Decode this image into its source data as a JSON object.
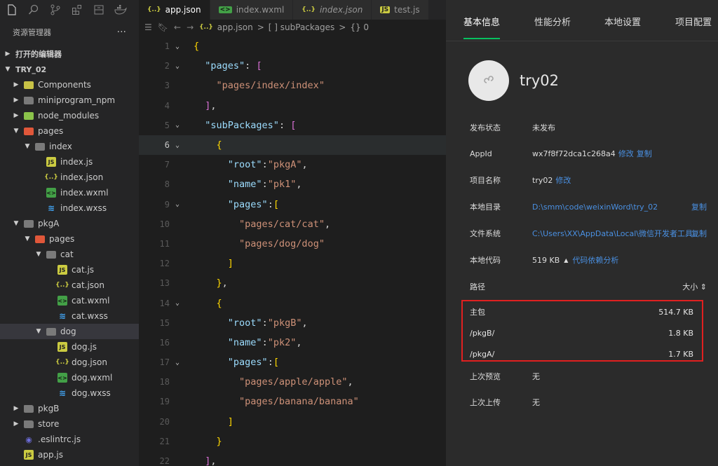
{
  "explorer": {
    "title": "资源管理器",
    "more": "···",
    "open_editors": "打开的编辑器",
    "project": "TRY_02",
    "items": [
      {
        "label": "Components",
        "depth": 1,
        "chev": "right",
        "icon": "folder-comp"
      },
      {
        "label": "miniprogram_npm",
        "depth": 1,
        "chev": "right",
        "icon": "folder"
      },
      {
        "label": "node_modules",
        "depth": 1,
        "chev": "right",
        "icon": "folder-node"
      },
      {
        "label": "pages",
        "depth": 1,
        "chev": "down",
        "icon": "folder-red"
      },
      {
        "label": "index",
        "depth": 2,
        "chev": "down",
        "icon": "folder-open"
      },
      {
        "label": "index.js",
        "depth": 3,
        "chev": "",
        "icon": "js"
      },
      {
        "label": "index.json",
        "depth": 3,
        "chev": "",
        "icon": "json"
      },
      {
        "label": "index.wxml",
        "depth": 3,
        "chev": "",
        "icon": "wxml"
      },
      {
        "label": "index.wxss",
        "depth": 3,
        "chev": "",
        "icon": "wxss"
      },
      {
        "label": "pkgA",
        "depth": 1,
        "chev": "down",
        "icon": "folder-open"
      },
      {
        "label": "pages",
        "depth": 2,
        "chev": "down",
        "icon": "folder-red"
      },
      {
        "label": "cat",
        "depth": 3,
        "chev": "down",
        "icon": "folder-open"
      },
      {
        "label": "cat.js",
        "depth": 4,
        "chev": "",
        "icon": "js"
      },
      {
        "label": "cat.json",
        "depth": 4,
        "chev": "",
        "icon": "json"
      },
      {
        "label": "cat.wxml",
        "depth": 4,
        "chev": "",
        "icon": "wxml"
      },
      {
        "label": "cat.wxss",
        "depth": 4,
        "chev": "",
        "icon": "wxss"
      },
      {
        "label": "dog",
        "depth": 3,
        "chev": "down",
        "icon": "folder-open",
        "selected": true
      },
      {
        "label": "dog.js",
        "depth": 4,
        "chev": "",
        "icon": "js"
      },
      {
        "label": "dog.json",
        "depth": 4,
        "chev": "",
        "icon": "json"
      },
      {
        "label": "dog.wxml",
        "depth": 4,
        "chev": "",
        "icon": "wxml"
      },
      {
        "label": "dog.wxss",
        "depth": 4,
        "chev": "",
        "icon": "wxss"
      },
      {
        "label": "pkgB",
        "depth": 1,
        "chev": "right",
        "icon": "folder"
      },
      {
        "label": "store",
        "depth": 1,
        "chev": "right",
        "icon": "folder"
      },
      {
        "label": ".eslintrc.js",
        "depth": 1,
        "chev": "",
        "icon": "eslint"
      },
      {
        "label": "app.js",
        "depth": 1,
        "chev": "",
        "icon": "js"
      }
    ]
  },
  "tabs": [
    {
      "label": "app.json",
      "icon": "{..}",
      "type": "json",
      "active": true
    },
    {
      "label": "index.wxml",
      "icon": "<>",
      "type": "wxml"
    },
    {
      "label": "index.json",
      "icon": "{..}",
      "type": "json",
      "italic": true
    },
    {
      "label": "test.js",
      "icon": "JS",
      "type": "js"
    }
  ],
  "breadcrumb": [
    "app.json",
    ">",
    "[ ] subPackages",
    ">",
    "{} 0"
  ],
  "code": [
    {
      "n": "1",
      "fold": "v",
      "t": [
        [
          "b",
          "{"
        ]
      ]
    },
    {
      "n": "2",
      "fold": "v",
      "t": [
        [
          "w",
          "  "
        ],
        [
          "k",
          "\"pages\""
        ],
        [
          "w",
          ": "
        ],
        [
          "p",
          "["
        ]
      ]
    },
    {
      "n": "3",
      "fold": "",
      "t": [
        [
          "w",
          "    "
        ],
        [
          "s",
          "\"pages/index/index\""
        ]
      ]
    },
    {
      "n": "4",
      "fold": "",
      "t": [
        [
          "w",
          "  "
        ],
        [
          "p",
          "]"
        ],
        [
          "w",
          ","
        ]
      ]
    },
    {
      "n": "5",
      "fold": "v",
      "t": [
        [
          "w",
          "  "
        ],
        [
          "k",
          "\"subPackages\""
        ],
        [
          "w",
          ": "
        ],
        [
          "p",
          "["
        ]
      ]
    },
    {
      "n": "6",
      "fold": "v",
      "cur": true,
      "t": [
        [
          "w",
          "    "
        ],
        [
          "b",
          "{"
        ]
      ]
    },
    {
      "n": "7",
      "fold": "",
      "t": [
        [
          "w",
          "      "
        ],
        [
          "k",
          "\"root\""
        ],
        [
          "w",
          ":"
        ],
        [
          "s",
          "\"pkgA\""
        ],
        [
          "w",
          ","
        ]
      ]
    },
    {
      "n": "8",
      "fold": "",
      "t": [
        [
          "w",
          "      "
        ],
        [
          "k",
          "\"name\""
        ],
        [
          "w",
          ":"
        ],
        [
          "s",
          "\"pk1\""
        ],
        [
          "w",
          ","
        ]
      ]
    },
    {
      "n": "9",
      "fold": "v",
      "t": [
        [
          "w",
          "      "
        ],
        [
          "k",
          "\"pages\""
        ],
        [
          "w",
          ":"
        ],
        [
          "b",
          "["
        ]
      ]
    },
    {
      "n": "10",
      "fold": "",
      "t": [
        [
          "w",
          "        "
        ],
        [
          "s",
          "\"pages/cat/cat\""
        ],
        [
          "w",
          ","
        ]
      ]
    },
    {
      "n": "11",
      "fold": "",
      "t": [
        [
          "w",
          "        "
        ],
        [
          "s",
          "\"pages/dog/dog\""
        ]
      ]
    },
    {
      "n": "12",
      "fold": "",
      "t": [
        [
          "w",
          "      "
        ],
        [
          "b",
          "]"
        ]
      ]
    },
    {
      "n": "13",
      "fold": "",
      "t": [
        [
          "w",
          "    "
        ],
        [
          "b",
          "}"
        ],
        [
          "w",
          ","
        ]
      ]
    },
    {
      "n": "14",
      "fold": "v",
      "t": [
        [
          "w",
          "    "
        ],
        [
          "b",
          "{"
        ]
      ]
    },
    {
      "n": "15",
      "fold": "",
      "t": [
        [
          "w",
          "      "
        ],
        [
          "k",
          "\"root\""
        ],
        [
          "w",
          ":"
        ],
        [
          "s",
          "\"pkgB\""
        ],
        [
          "w",
          ","
        ]
      ]
    },
    {
      "n": "16",
      "fold": "",
      "t": [
        [
          "w",
          "      "
        ],
        [
          "k",
          "\"name\""
        ],
        [
          "w",
          ":"
        ],
        [
          "s",
          "\"pk2\""
        ],
        [
          "w",
          ","
        ]
      ]
    },
    {
      "n": "17",
      "fold": "v",
      "t": [
        [
          "w",
          "      "
        ],
        [
          "k",
          "\"pages\""
        ],
        [
          "w",
          ":"
        ],
        [
          "b",
          "["
        ]
      ]
    },
    {
      "n": "18",
      "fold": "",
      "t": [
        [
          "w",
          "        "
        ],
        [
          "s",
          "\"pages/apple/apple\""
        ],
        [
          "w",
          ","
        ]
      ]
    },
    {
      "n": "19",
      "fold": "",
      "t": [
        [
          "w",
          "        "
        ],
        [
          "s",
          "\"pages/banana/banana\""
        ]
      ]
    },
    {
      "n": "20",
      "fold": "",
      "t": [
        [
          "w",
          "      "
        ],
        [
          "b",
          "]"
        ]
      ]
    },
    {
      "n": "21",
      "fold": "",
      "t": [
        [
          "w",
          "    "
        ],
        [
          "b",
          "}"
        ]
      ]
    },
    {
      "n": "22",
      "fold": "",
      "t": [
        [
          "w",
          "  "
        ],
        [
          "p",
          "]"
        ],
        [
          "w",
          ","
        ]
      ]
    }
  ],
  "details": {
    "tabs": [
      "基本信息",
      "性能分析",
      "本地设置",
      "项目配置"
    ],
    "project_name": "try02",
    "rows": {
      "status_label": "发布状态",
      "status_value": "未发布",
      "appid_label": "AppId",
      "appid_value": "wx7f8f72dca1c268a4",
      "appid_edit": "修改",
      "appid_copy": "复制",
      "name_label": "项目名称",
      "name_value": "try02",
      "name_edit": "修改",
      "dir_label": "本地目录",
      "dir_value": "D:\\smm\\code\\weixinWord\\try_02",
      "dir_copy": "复制",
      "fs_label": "文件系统",
      "fs_value": "C:\\Users\\XX\\AppData\\Local\\微信开发者工具...",
      "fs_copy": "复制",
      "code_label": "本地代码",
      "code_value": "519 KB",
      "code_caret": "▲",
      "code_link": "代码依赖分析",
      "path_label": "路径",
      "size_label": "大小 ⇕",
      "prev_label": "上次预览",
      "prev_value": "无",
      "upload_label": "上次上传",
      "upload_value": "无"
    },
    "packages": [
      {
        "name": "主包",
        "size": "514.7 KB"
      },
      {
        "name": "/pkgB/",
        "size": "1.8 KB"
      },
      {
        "name": "/pkgA/",
        "size": "1.7 KB"
      }
    ]
  }
}
